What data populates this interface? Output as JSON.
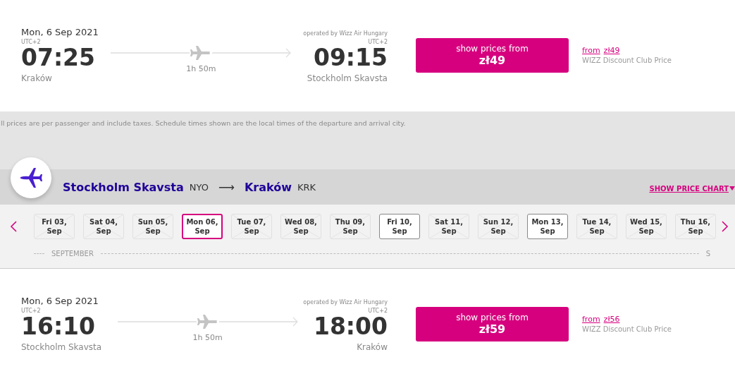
{
  "flights": [
    {
      "date": "Mon, 6 Sep 2021",
      "operator": "operated by Wizz Air Hungary",
      "departure": {
        "tz": "UTC+2",
        "time": "07:25",
        "city": "Kraków"
      },
      "arrival": {
        "tz": "UTC+2",
        "time": "09:15",
        "city": "Stockholm Skavsta"
      },
      "duration": "1h 50m",
      "button": {
        "label": "show prices from",
        "price": "zł49"
      },
      "club": {
        "from": "from",
        "price": "zł49",
        "label": "WIZZ Discount Club Price"
      }
    }
  ],
  "notice": "ll prices are per passenger and include taxes. Schedule times shown are the local times of the departure and arrival city.",
  "route": {
    "origin": "Stockholm Skavsta",
    "origin_code": "NYO",
    "arrow": "⟶",
    "destination": "Kraków",
    "destination_code": "KRK",
    "chart_link": "SHOW PRICE CHART"
  },
  "dates": [
    {
      "day": "Fri 03,",
      "month": "Sep",
      "available": false,
      "selected": false
    },
    {
      "day": "Sat 04,",
      "month": "Sep",
      "available": false,
      "selected": false
    },
    {
      "day": "Sun 05,",
      "month": "Sep",
      "available": false,
      "selected": false
    },
    {
      "day": "Mon 06,",
      "month": "Sep",
      "available": true,
      "selected": true
    },
    {
      "day": "Tue 07,",
      "month": "Sep",
      "available": false,
      "selected": false
    },
    {
      "day": "Wed 08,",
      "month": "Sep",
      "available": false,
      "selected": false
    },
    {
      "day": "Thu 09,",
      "month": "Sep",
      "available": false,
      "selected": false
    },
    {
      "day": "Fri 10,",
      "month": "Sep",
      "available": true,
      "selected": false
    },
    {
      "day": "Sat 11,",
      "month": "Sep",
      "available": false,
      "selected": false
    },
    {
      "day": "Sun 12,",
      "month": "Sep",
      "available": false,
      "selected": false
    },
    {
      "day": "Mon 13,",
      "month": "Sep",
      "available": true,
      "selected": false
    },
    {
      "day": "Tue 14,",
      "month": "Sep",
      "available": false,
      "selected": false
    },
    {
      "day": "Wed 15,",
      "month": "Sep",
      "available": false,
      "selected": false
    },
    {
      "day": "Thu 16,",
      "month": "Sep",
      "available": false,
      "selected": false
    }
  ],
  "months": [
    "SEPTEMBER",
    "S"
  ],
  "return_flights": [
    {
      "date": "Mon, 6 Sep 2021",
      "operator": "operated by Wizz Air Hungary",
      "departure": {
        "tz": "UTC+2",
        "time": "16:10",
        "city": "Stockholm Skavsta"
      },
      "arrival": {
        "tz": "UTC+2",
        "time": "18:00",
        "city": "Kraków"
      },
      "duration": "1h 50m",
      "button": {
        "label": "show prices from",
        "price": "zł59"
      },
      "club": {
        "from": "from",
        "price": "zł56",
        "label": "WIZZ Discount Club Price"
      }
    }
  ]
}
